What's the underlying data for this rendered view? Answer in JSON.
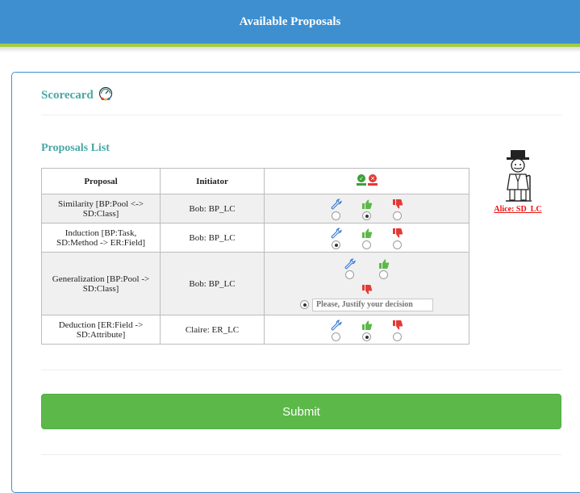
{
  "header": {
    "title": "Available Proposals"
  },
  "scorecard": {
    "title": "Scorecard",
    "icon": "gauge-icon"
  },
  "proposals_list": {
    "title": "Proposals List",
    "columns": {
      "proposal": "Proposal",
      "initiator": "Initiator",
      "vote_icon": "vote-indicator-icon"
    },
    "rows": [
      {
        "proposal": "Similarity [BP:Pool <-> SD:Class]",
        "initiator": "Bob: BP_LC",
        "selected": "approve",
        "layout": "inline"
      },
      {
        "proposal": "Induction [BP:Task, SD:Method -> ER:Field]",
        "initiator": "Bob: BP_LC",
        "selected": "modify",
        "layout": "inline"
      },
      {
        "proposal": "Generalization [BP:Pool -> SD:Class]",
        "initiator": "Bob: BP_LC",
        "selected": "reject",
        "layout": "expanded",
        "justify_placeholder": "Please, Justify your decision"
      },
      {
        "proposal": "Deduction [ER:Field -> SD:Attribute]",
        "initiator": "Claire: ER_LC",
        "selected": "approve",
        "layout": "inline"
      }
    ]
  },
  "user": {
    "name": "Alice: SD_LC",
    "avatar": "gentleman-avatar"
  },
  "submit": {
    "label": "Submit"
  },
  "colors": {
    "header": "#3d8fd0",
    "stripe": "#9fcd3c",
    "accent_text": "#4aa7a7",
    "submit": "#5cb848",
    "wrench": "#3a7bd5",
    "thumbs_up": "#5cb848",
    "thumbs_down": "#e53935",
    "user_label": "#e11111"
  }
}
